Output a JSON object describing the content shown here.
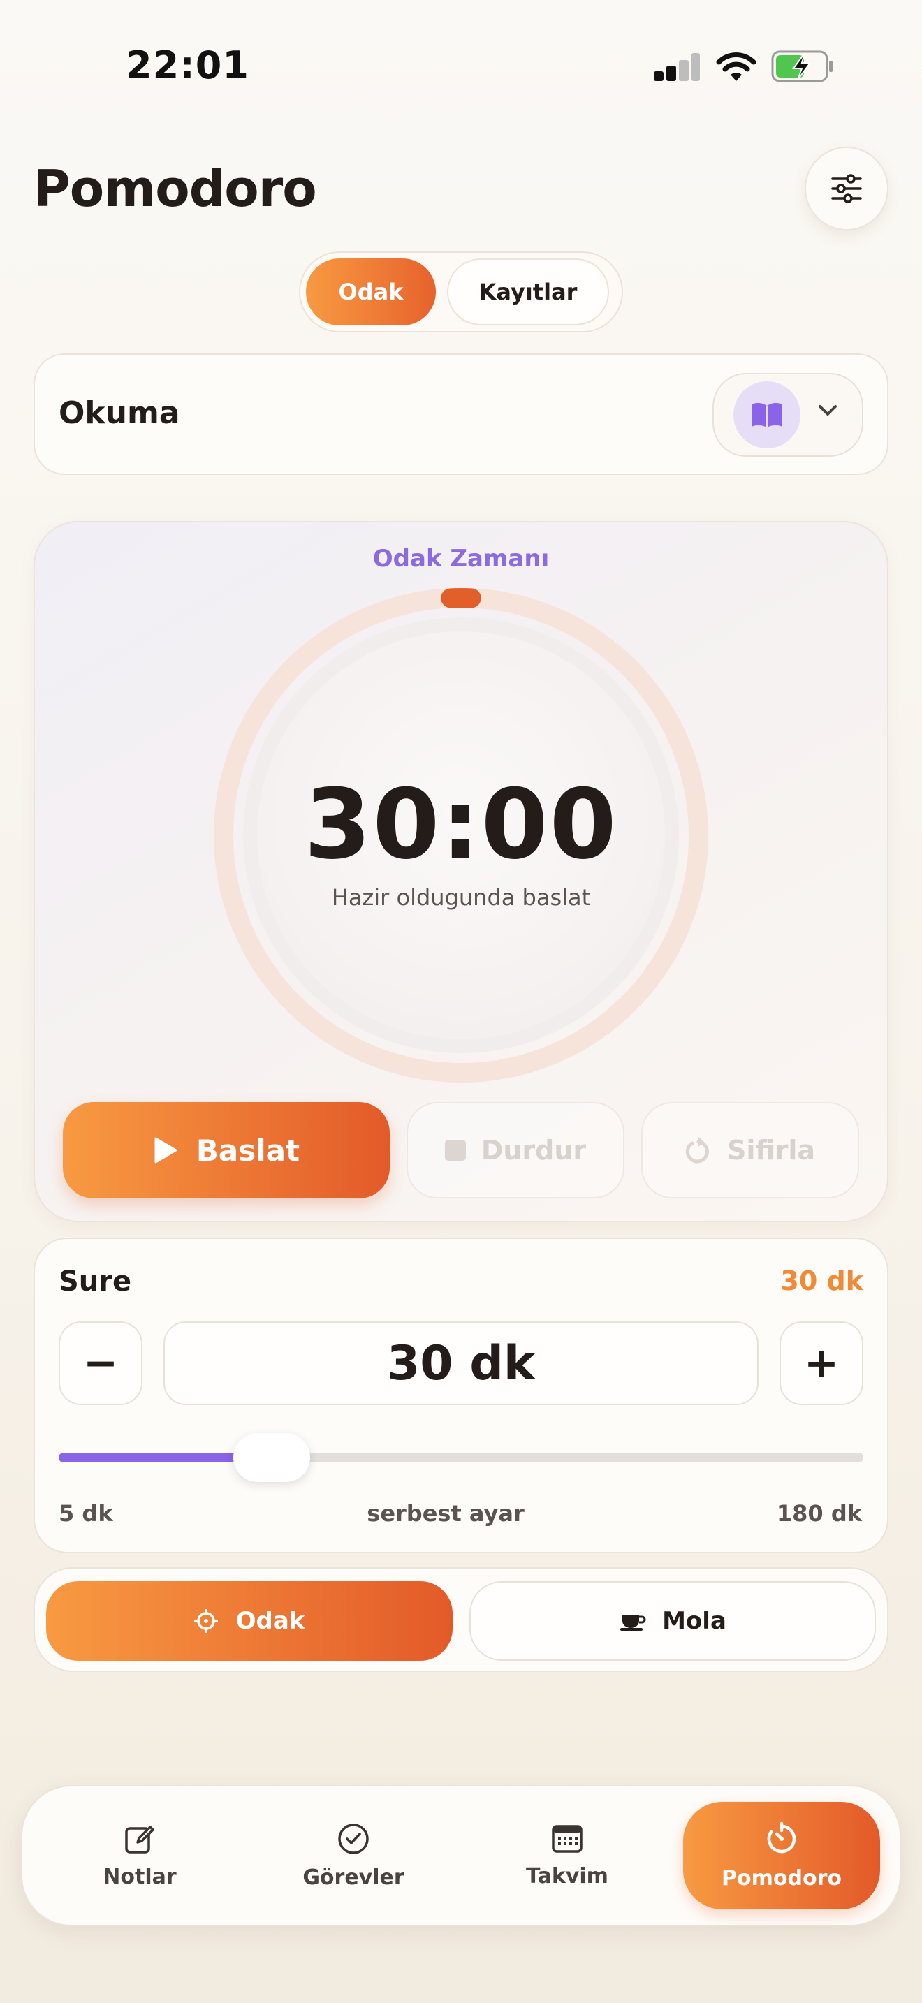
{
  "status_bar": {
    "time": "22:01"
  },
  "header": {
    "title": "Pomodoro"
  },
  "segments": {
    "focus": "Odak",
    "logs": "Kayıtlar"
  },
  "category": {
    "name": "Okuma",
    "icon": "book-icon"
  },
  "timer": {
    "label": "Odak Zamanı",
    "value": "30:00",
    "hint": "Hazir oldugunda baslat",
    "progress": 0.0
  },
  "controls": {
    "start": "Baslat",
    "stop": "Durdur",
    "reset": "Sifirla"
  },
  "duration": {
    "title": "Sure",
    "badge": "30 dk",
    "value": "30 dk",
    "minus": "−",
    "plus": "+",
    "min_label": "5 dk",
    "mid_label": "serbest ayar",
    "max_label": "180 dk",
    "minutes": 30,
    "min_minutes": 5,
    "max_minutes": 180
  },
  "modes": {
    "focus": "Odak",
    "break": "Mola"
  },
  "tabs": [
    {
      "label": "Notlar",
      "icon": "edit-note-icon"
    },
    {
      "label": "Görevler",
      "icon": "check-circle-icon"
    },
    {
      "label": "Takvim",
      "icon": "calendar-icon"
    },
    {
      "label": "Pomodoro",
      "icon": "timer-icon"
    }
  ],
  "colors": {
    "accent_orange": "#f28a35",
    "accent_orange_dark": "#e35a29",
    "accent_purple": "#8c6ae0",
    "text_dark": "#241c19"
  }
}
